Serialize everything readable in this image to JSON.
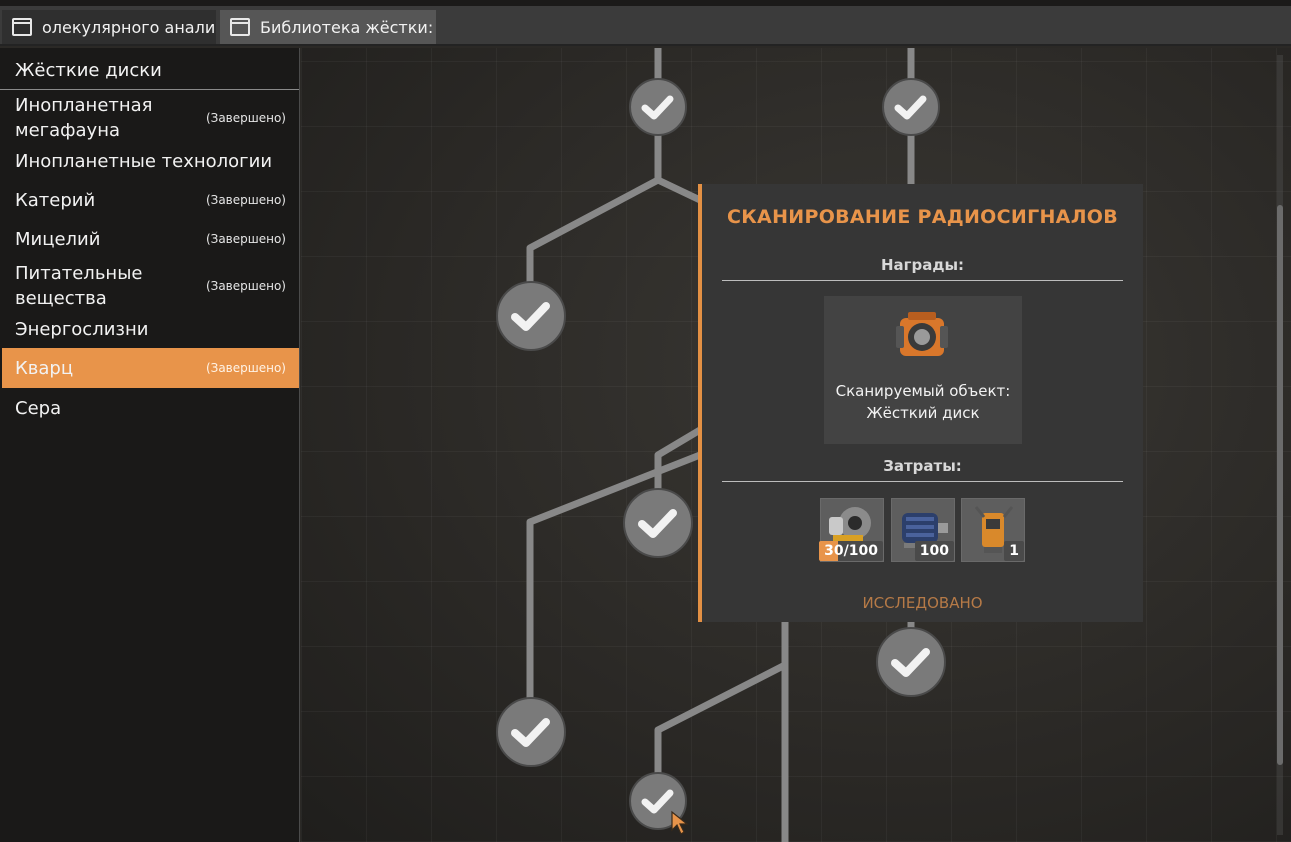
{
  "tabs": [
    {
      "label": "олекулярного анали"
    },
    {
      "label": "Библиотека жёстки:"
    }
  ],
  "sidebar": {
    "header": "Жёсткие диски",
    "items": [
      {
        "label": "Инопланетная мегафауна",
        "status": "(Завершено)",
        "selected": false
      },
      {
        "label": "Инопланетные технологии",
        "status": "",
        "selected": false
      },
      {
        "label": "Катерий",
        "status": "(Завершено)",
        "selected": false
      },
      {
        "label": "Мицелий",
        "status": "(Завершено)",
        "selected": false
      },
      {
        "label": "Питательные вещества",
        "status": "(Завершено)",
        "selected": false
      },
      {
        "label": "Энергослизни",
        "status": "",
        "selected": false
      },
      {
        "label": "Кварц",
        "status": "(Завершено)",
        "selected": true
      },
      {
        "label": "Сера",
        "status": "",
        "selected": false
      }
    ]
  },
  "tooltip": {
    "title": "СКАНИРОВАНИЕ РАДИОСИГНАЛОВ",
    "rewards_label": "Награды:",
    "reward": {
      "line1": "Сканируемый объект:",
      "line2": "Жёсткий диск",
      "icon": "hard-drive-icon"
    },
    "costs_label": "Затраты:",
    "costs": [
      {
        "icon": "reinforced-plate-icon",
        "amount": "30/100",
        "progress": 0.3
      },
      {
        "icon": "motor-icon",
        "amount": "100"
      },
      {
        "icon": "radio-tower-icon",
        "amount": "1"
      }
    ],
    "status": "ИССЛЕДОВАНО"
  },
  "tree": {
    "node_icon": "checkmark-icon"
  },
  "colors": {
    "accent": "#e8944a",
    "panel": "#363636",
    "node": "#7a7a7a"
  }
}
